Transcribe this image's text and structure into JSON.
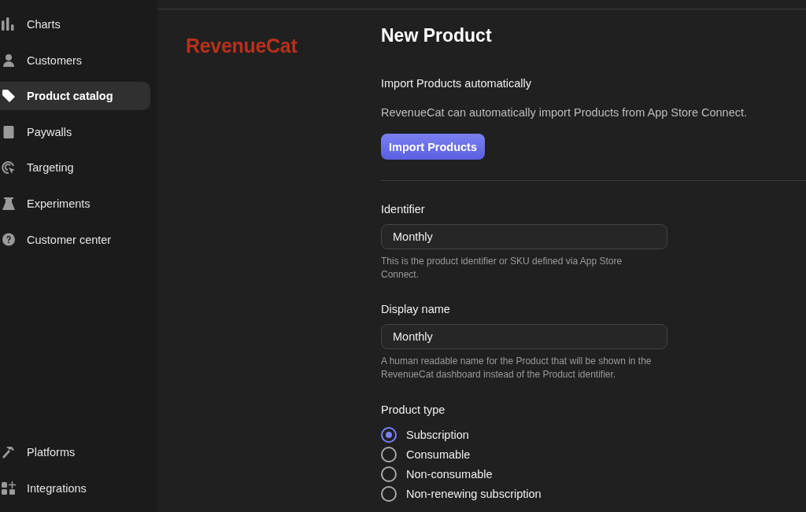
{
  "sidebar": {
    "items": [
      {
        "label": "Charts",
        "selected": false
      },
      {
        "label": "Customers",
        "selected": false
      },
      {
        "label": "Product catalog",
        "selected": true
      },
      {
        "label": "Paywalls",
        "selected": false
      },
      {
        "label": "Targeting",
        "selected": false
      },
      {
        "label": "Experiments",
        "selected": false
      },
      {
        "label": "Customer center",
        "selected": false
      }
    ],
    "bottom_items": [
      {
        "label": "Platforms",
        "selected": false
      },
      {
        "label": "Integrations",
        "selected": false
      }
    ]
  },
  "logo": "RevenueCat",
  "form": {
    "title": "New Product",
    "import": {
      "heading": "Import Products automatically",
      "description": "RevenueCat can automatically import Products from App Store Connect.",
      "button": "Import Products"
    },
    "fields": [
      {
        "label": "Identifier",
        "value": "Monthly",
        "help": "This is the product identifier or SKU defined via App Store Connect."
      },
      {
        "label": "Display name",
        "value": "Monthly",
        "help": "A human readable name for the Product that will be shown in the RevenueCat dashboard instead of the Product identifier."
      }
    ],
    "product_type": {
      "label": "Product type",
      "options": [
        {
          "label": "Subscription",
          "selected": true
        },
        {
          "label": "Consumable",
          "selected": false
        },
        {
          "label": "Non-consumable",
          "selected": false
        },
        {
          "label": "Non-renewing subscription",
          "selected": false
        }
      ]
    }
  }
}
